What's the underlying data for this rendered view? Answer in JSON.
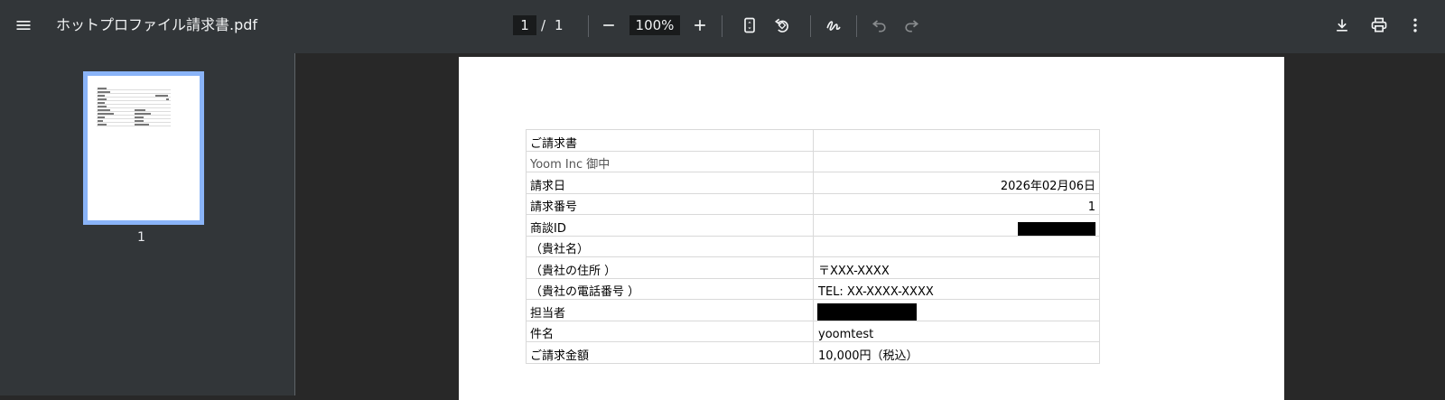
{
  "toolbar": {
    "title": "ホットプロファイル請求書.pdf",
    "page_current": "1",
    "page_sep": "/",
    "page_total": "1",
    "zoom": "100%",
    "icons": {
      "menu": "menu-icon",
      "zoom_out": "minus-icon",
      "zoom_in": "plus-icon",
      "fit": "fit-page-icon",
      "rotate": "rotate-icon",
      "annotate": "draw-icon",
      "undo": "undo-icon",
      "redo": "redo-icon",
      "download": "download-icon",
      "print": "print-icon",
      "more": "more-vert-icon"
    }
  },
  "sidebar": {
    "thumbnails": [
      {
        "label": "1",
        "selected": true
      }
    ]
  },
  "invoice": {
    "rows": [
      {
        "key": "ご請求書",
        "value": ""
      },
      {
        "key": "Yoom Inc 御中",
        "value": ""
      },
      {
        "key": "請求日",
        "value": "2026年02月06日"
      },
      {
        "key": "請求番号",
        "value": "1"
      },
      {
        "key": "商談ID",
        "value": ""
      },
      {
        "key": "（貴社名）",
        "value": ""
      },
      {
        "key": "（貴社の住所 ）",
        "value": "〒XXX-XXXX"
      },
      {
        "key": "（貴社の電話番号 ）",
        "value": "TEL: XX-XXXX-XXXX"
      },
      {
        "key": "担当者",
        "value": ""
      },
      {
        "key": "件名",
        "value": "yoomtest"
      },
      {
        "key": "ご請求金額",
        "value": "10,000円（税込）"
      }
    ]
  },
  "colors": {
    "toolbar_bg": "#323639",
    "viewer_bg": "#282828",
    "thumb_selected": "#8ab4f8",
    "redaction": "#000000"
  }
}
